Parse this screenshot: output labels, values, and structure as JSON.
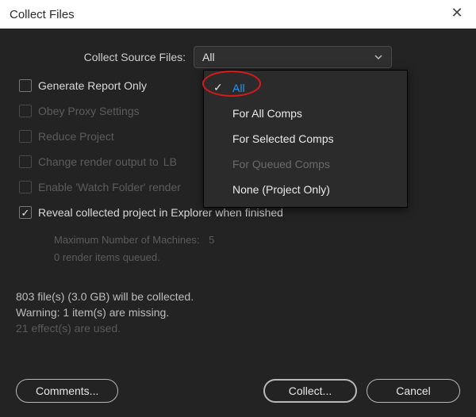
{
  "titlebar": {
    "title": "Collect Files"
  },
  "labels": {
    "collectSource": "Collect Source Files:"
  },
  "select": {
    "value": "All"
  },
  "dropdown": {
    "items": [
      {
        "label": "All",
        "selected": true,
        "disabled": false
      },
      {
        "label": "For All Comps",
        "selected": false,
        "disabled": false
      },
      {
        "label": "For Selected Comps",
        "selected": false,
        "disabled": false
      },
      {
        "label": "For Queued Comps",
        "selected": false,
        "disabled": true
      },
      {
        "label": "None (Project Only)",
        "selected": false,
        "disabled": false
      }
    ]
  },
  "checks": {
    "generateReport": {
      "label": "Generate Report Only",
      "checked": false,
      "disabled": false
    },
    "obeyProxy": {
      "label": "Obey Proxy Settings",
      "checked": false,
      "disabled": true
    },
    "reduceProject": {
      "label": "Reduce Project",
      "checked": false,
      "disabled": true
    },
    "changeOutput": {
      "label": "Change render output to",
      "suffix": "LB",
      "checked": false,
      "disabled": true
    },
    "watchFolder": {
      "label": "Enable 'Watch Folder' render",
      "checked": false,
      "disabled": true
    },
    "reveal": {
      "label": "Reveal collected project in Explorer when finished",
      "checked": true,
      "disabled": false
    }
  },
  "machines": {
    "maxLabel": "Maximum Number of Machines:",
    "maxValue": "5",
    "queued": "0 render items queued."
  },
  "status": {
    "line1": "803 file(s) (3.0 GB) will be collected.",
    "line2": "Warning: 1 item(s) are missing.",
    "line3": "21 effect(s) are used."
  },
  "buttons": {
    "comments": "Comments...",
    "collect": "Collect...",
    "cancel": "Cancel"
  }
}
